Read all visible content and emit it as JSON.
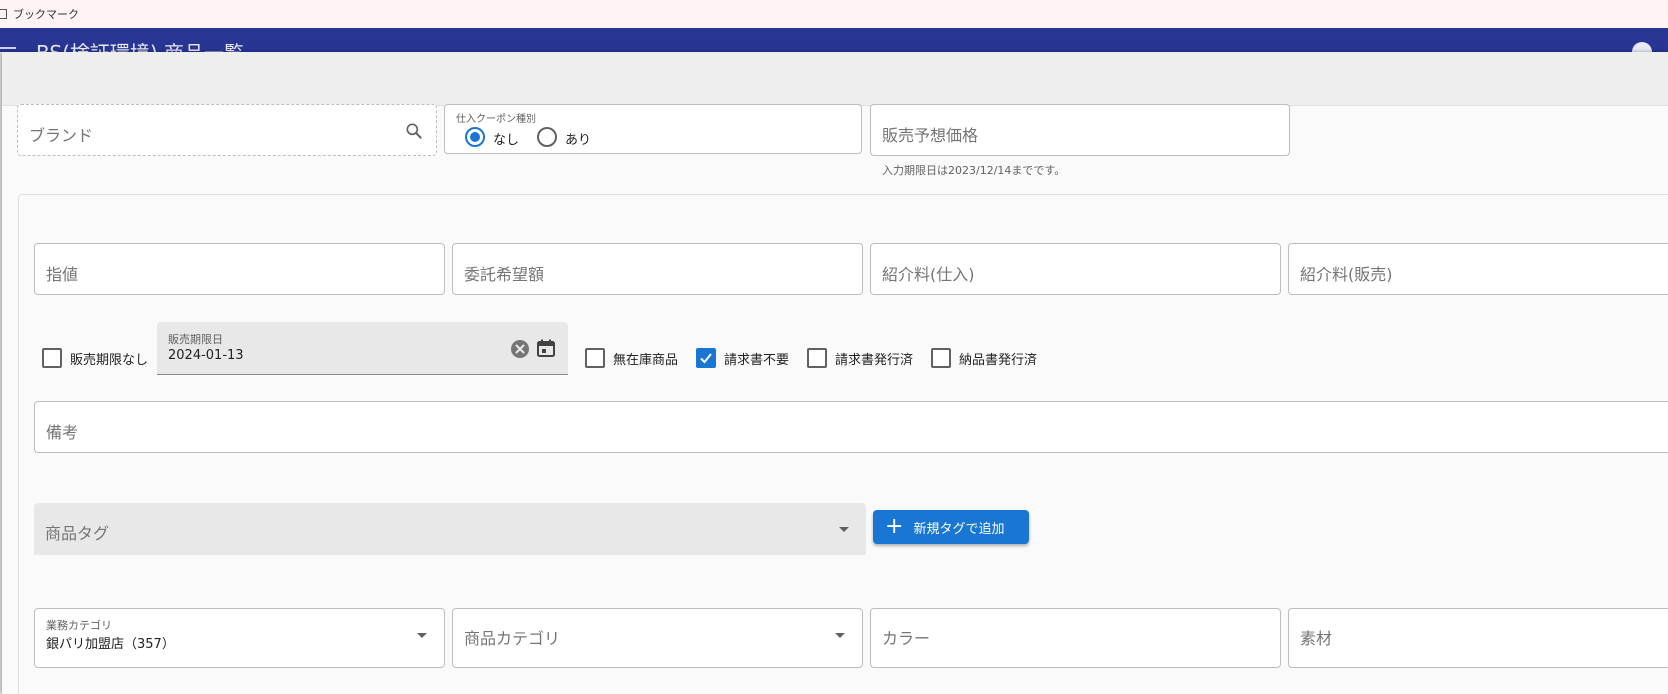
{
  "bookmark_bar": {
    "label": "ブックマーク"
  },
  "app_header": {
    "title": "BS(検証環境) 商品一覧"
  },
  "form": {
    "brand": {
      "placeholder": "ブランド"
    },
    "coupon_type": {
      "label": "仕入クーポン種別",
      "options": [
        {
          "label": "なし",
          "selected": true
        },
        {
          "label": "あり",
          "selected": false
        }
      ]
    },
    "expected_price": {
      "placeholder": "販売予想価格",
      "helper": "入力期限日は2023/12/14までです。"
    },
    "price_row": [
      {
        "placeholder": "指値"
      },
      {
        "placeholder": "委託希望額"
      },
      {
        "placeholder": "紹介料(仕入)"
      },
      {
        "placeholder": "紹介料(販売)"
      }
    ],
    "no_sale_limit": {
      "label": "販売期限なし",
      "checked": false
    },
    "sale_deadline": {
      "label": "販売期限日",
      "value": "2024-01-13"
    },
    "flags": [
      {
        "label": "無在庫商品",
        "checked": false
      },
      {
        "label": "請求書不要",
        "checked": true
      },
      {
        "label": "請求書発行済",
        "checked": false
      },
      {
        "label": "納品書発行済",
        "checked": false
      }
    ],
    "remarks": {
      "placeholder": "備考"
    },
    "product_tag": {
      "placeholder": "商品タグ"
    },
    "add_tag_button": {
      "label": "新規タグで追加"
    },
    "business_category": {
      "label": "業務カテゴリ",
      "value": "銀パリ加盟店（357）"
    },
    "product_category": {
      "placeholder": "商品カテゴリ"
    },
    "color": {
      "placeholder": "カラー"
    },
    "material": {
      "placeholder": "素材"
    }
  }
}
